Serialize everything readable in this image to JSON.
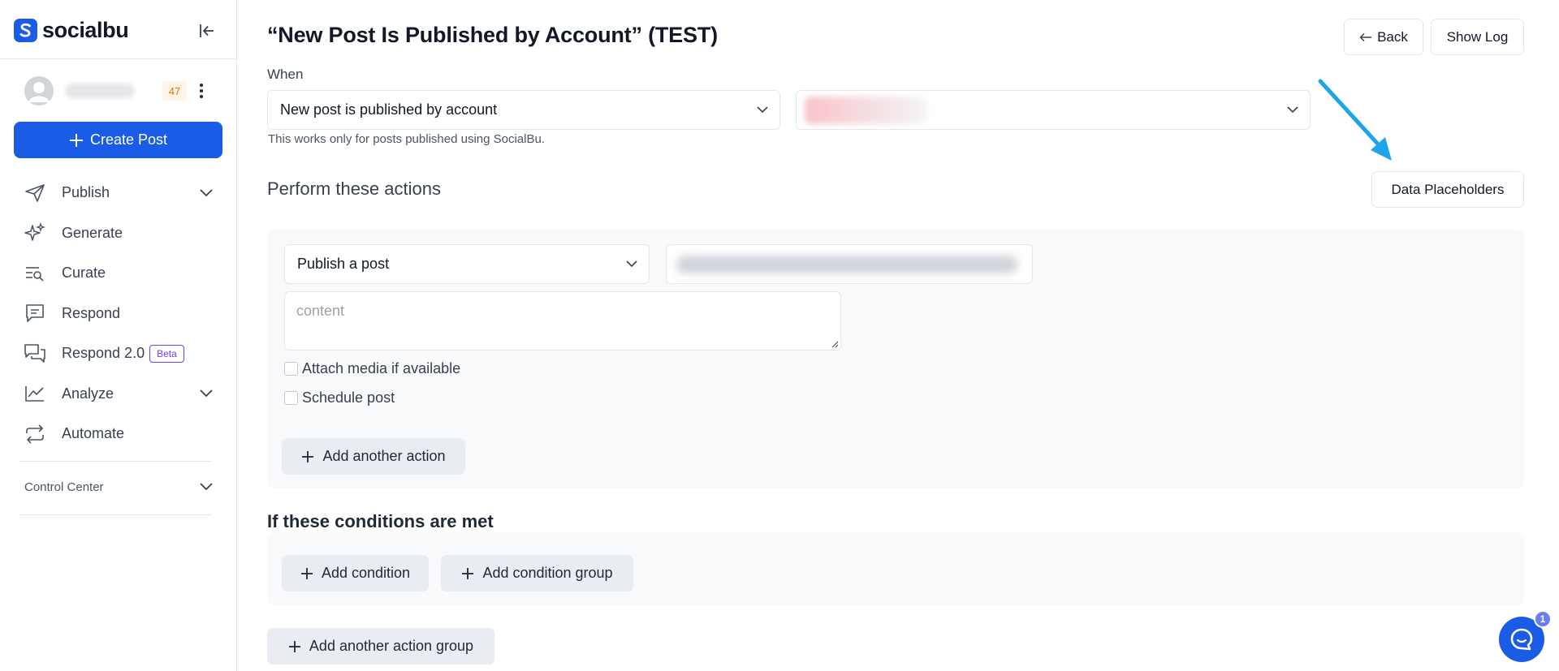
{
  "app": {
    "brand": "socialbu",
    "user_count": "47"
  },
  "sidebar": {
    "create_post_label": "Create Post",
    "items": [
      {
        "label": "Publish",
        "icon": "paper-plane-icon",
        "has_chevron": true
      },
      {
        "label": "Generate",
        "icon": "sparkles-icon",
        "has_chevron": false
      },
      {
        "label": "Curate",
        "icon": "curate-search-icon",
        "has_chevron": false
      },
      {
        "label": "Respond",
        "icon": "chat-square-icon",
        "has_chevron": false
      },
      {
        "label": "Respond 2.0",
        "icon": "chat-double-icon",
        "has_chevron": false,
        "badge": "Beta"
      },
      {
        "label": "Analyze",
        "icon": "line-chart-icon",
        "has_chevron": true
      },
      {
        "label": "Automate",
        "icon": "repeat-icon",
        "has_chevron": false
      }
    ],
    "control_center_label": "Control Center"
  },
  "header": {
    "title": "“New Post Is Published by Account” (TEST)",
    "back_label": "Back",
    "show_log_label": "Show Log"
  },
  "trigger": {
    "when_label": "When",
    "event_value": "New post is published by account",
    "hint": "This works only for posts published using SocialBu."
  },
  "actions": {
    "section_title": "Perform these actions",
    "data_placeholders_label": "Data Placeholders",
    "action_value": "Publish a post",
    "content_placeholder": "content",
    "attach_media_label": "Attach media if available",
    "schedule_post_label": "Schedule post",
    "add_action_label": "Add another action"
  },
  "conditions": {
    "section_title": "If these conditions are met",
    "add_condition_label": "Add condition",
    "add_group_label": "Add condition group"
  },
  "footer": {
    "add_action_group_label": "Add another action group"
  },
  "chat": {
    "badge_count": "1"
  },
  "colors": {
    "brand_blue": "#1a5ce6",
    "beta_purple": "#7c3aed",
    "arrow_blue": "#1ea4e9",
    "count_orange": "#d97706"
  }
}
